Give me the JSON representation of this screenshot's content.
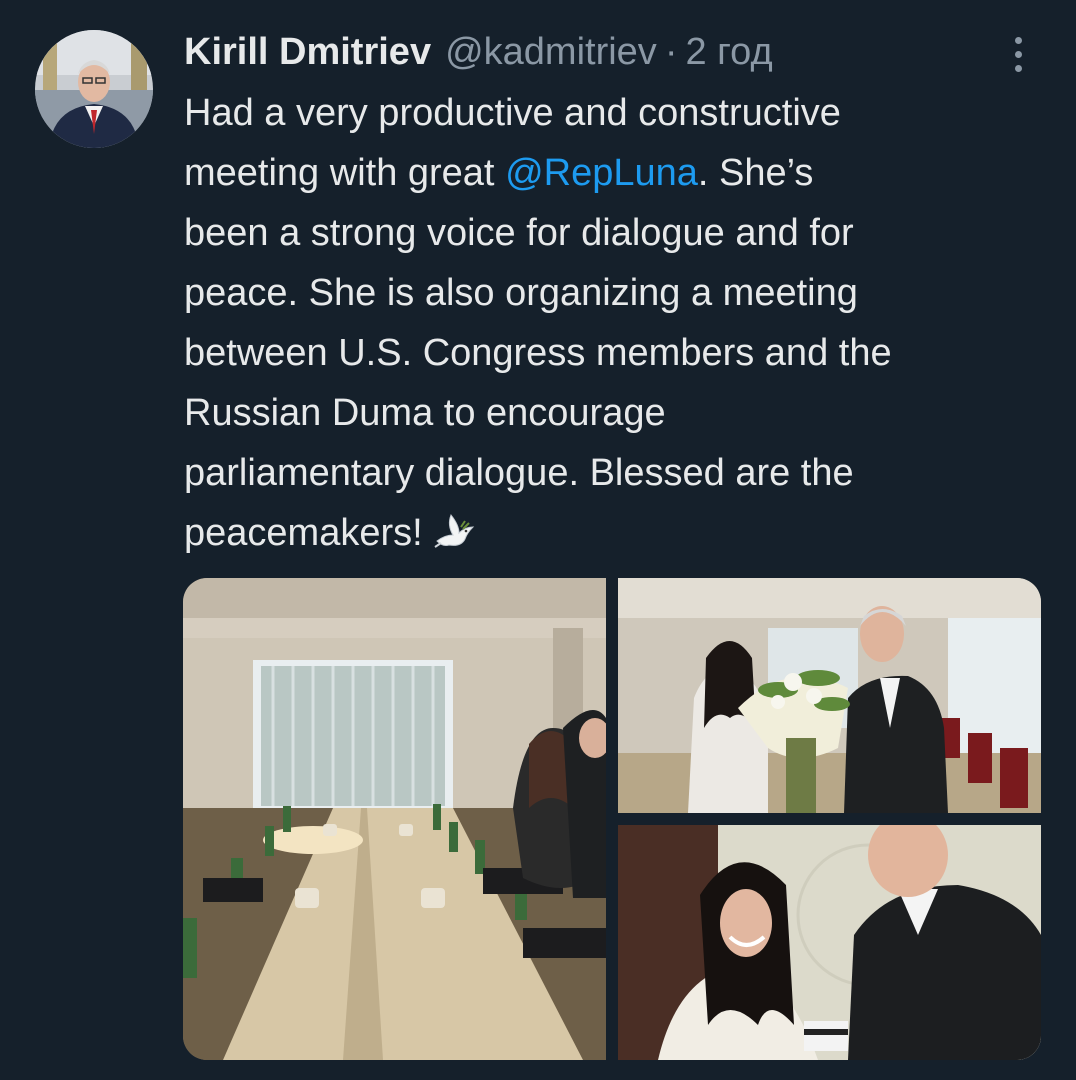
{
  "tweet": {
    "author": {
      "name": "Kirill Dmitriev",
      "handle": "@kadmitriev",
      "separator": "·",
      "timestamp": "2 год"
    },
    "text_lines": [
      {
        "before": "Had a very productive and constructive",
        "mention": "",
        "after": ""
      },
      {
        "before": "meeting with great ",
        "mention": "@RepLuna",
        "after": ". She’s"
      },
      {
        "before": "been a strong voice for dialogue and for",
        "mention": "",
        "after": ""
      },
      {
        "before": "peace. She is also organizing a meeting",
        "mention": "",
        "after": ""
      },
      {
        "before": "between U.S. Congress members and the",
        "mention": "",
        "after": ""
      },
      {
        "before": "Russian Duma to encourage",
        "mention": "",
        "after": ""
      },
      {
        "before": "parliamentary dialogue. Blessed are the",
        "mention": "",
        "after": ""
      },
      {
        "before": "peacemakers!",
        "mention": "",
        "after": ""
      }
    ],
    "emoji": "dove-icon",
    "media": [
      {
        "name": "meeting-room-photo"
      },
      {
        "name": "flowers-handover-photo"
      },
      {
        "name": "gift-handover-photo"
      }
    ]
  },
  "colors": {
    "background": "#15202b",
    "text": "#e7e9ea",
    "secondary": "#8b98a5",
    "link": "#1d9bf0"
  },
  "icons": {
    "more": "more-vertical-icon",
    "dove": "dove-icon"
  }
}
